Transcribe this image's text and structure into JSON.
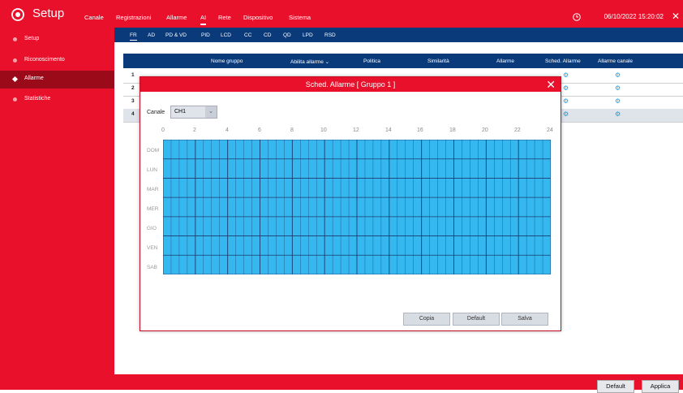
{
  "header": {
    "app_title": "Setup",
    "menu": [
      "Canale",
      "Registrazioni",
      "Allarme",
      "AI",
      "Rete",
      "Dispositivo",
      "Sistema"
    ],
    "active_menu": "AI",
    "datetime": "06/10/2022 15:20:02"
  },
  "sidebar": {
    "items": [
      {
        "label": "Setup"
      },
      {
        "label": "Riconoscimento"
      },
      {
        "label": "Allarme"
      },
      {
        "label": "Statistiche"
      }
    ],
    "active": "Allarme"
  },
  "subtabs": [
    "FR",
    "AD",
    "PD & VD",
    "PID",
    "LCD",
    "CC",
    "CD",
    "QD",
    "LPD",
    "RSD"
  ],
  "active_subtab": "FR",
  "table": {
    "headers": [
      "Nome gruppo",
      "Abilita allarme",
      "Politica",
      "Similarità",
      "Allarme",
      "Sched. Allarme",
      "Allarme canale"
    ],
    "row_numbers": [
      "1",
      "2",
      "3",
      "4"
    ]
  },
  "modal": {
    "title": "Sched. Allarme [ Gruppo 1 ]",
    "channel_label": "Canale",
    "channel_value": "CH1",
    "hours": [
      "0",
      "2",
      "4",
      "6",
      "8",
      "10",
      "12",
      "14",
      "16",
      "18",
      "20",
      "22",
      "24"
    ],
    "days": [
      "DOM",
      "LUN",
      "MAR",
      "MER",
      "GIO",
      "VEN",
      "SAB"
    ],
    "buttons": {
      "copy": "Copia",
      "default": "Default",
      "save": "Salva"
    },
    "schedule_color": "#35b8f0"
  },
  "footer": {
    "default": "Default",
    "apply": "Applica"
  },
  "colors": {
    "accent": "#e8102a",
    "navy": "#0a3a7a",
    "sidebar_active": "#9b0a18"
  }
}
